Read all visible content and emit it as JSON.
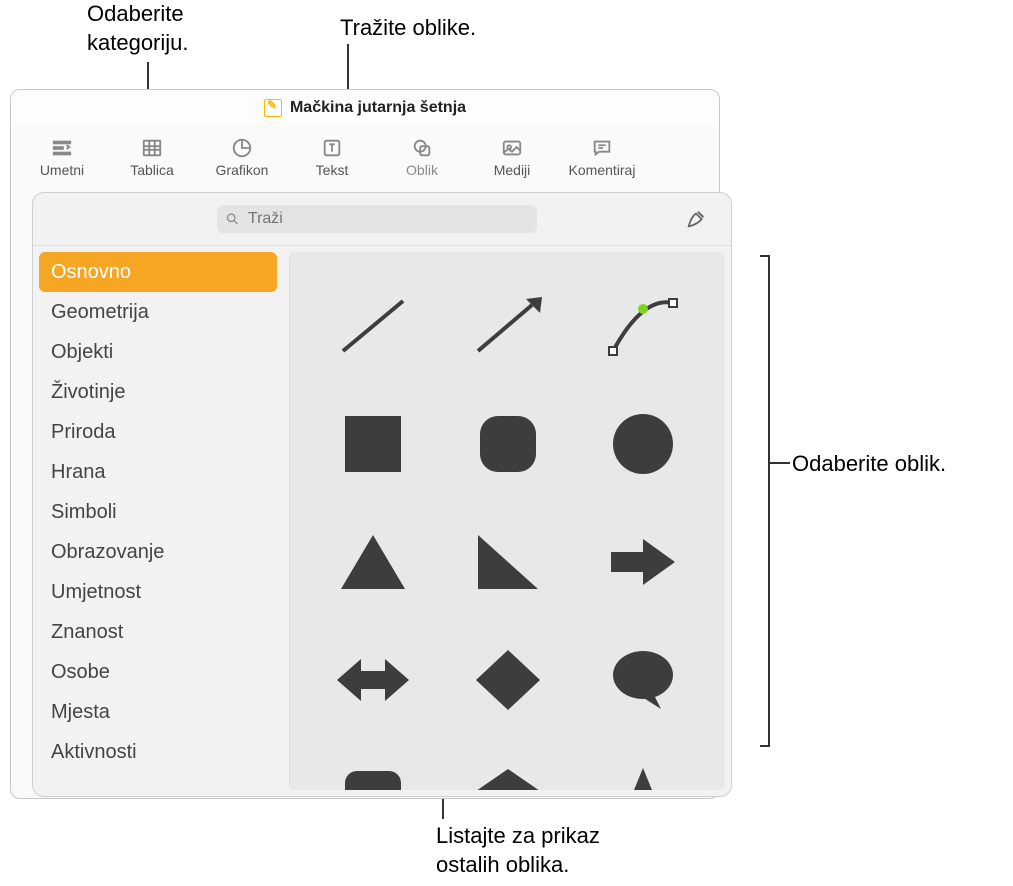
{
  "document": {
    "title": "Mačkina jutarnja šetnja"
  },
  "toolbar": {
    "items": [
      {
        "label": "Umetni"
      },
      {
        "label": "Tablica"
      },
      {
        "label": "Grafikon"
      },
      {
        "label": "Tekst"
      },
      {
        "label": "Oblik"
      },
      {
        "label": "Mediji"
      },
      {
        "label": "Komentiraj"
      }
    ]
  },
  "search": {
    "placeholder": "Traži"
  },
  "categories": [
    "Osnovno",
    "Geometrija",
    "Objekti",
    "Životinje",
    "Priroda",
    "Hrana",
    "Simboli",
    "Obrazovanje",
    "Umjetnost",
    "Znanost",
    "Osobe",
    "Mjesta",
    "Aktivnosti"
  ],
  "shapes": [
    "line",
    "arrow-line",
    "curve",
    "square",
    "rounded-square",
    "circle",
    "triangle",
    "right-triangle",
    "arrow-right",
    "arrow-both",
    "diamond",
    "speech-bubble",
    "callout-box",
    "pentagon",
    "star"
  ],
  "callouts": {
    "category": "Odaberite\nkategoriju.",
    "search": "Tražite oblike.",
    "shape": "Odaberite oblik.",
    "scroll": "Listajte za prikaz\nostalih oblika."
  }
}
